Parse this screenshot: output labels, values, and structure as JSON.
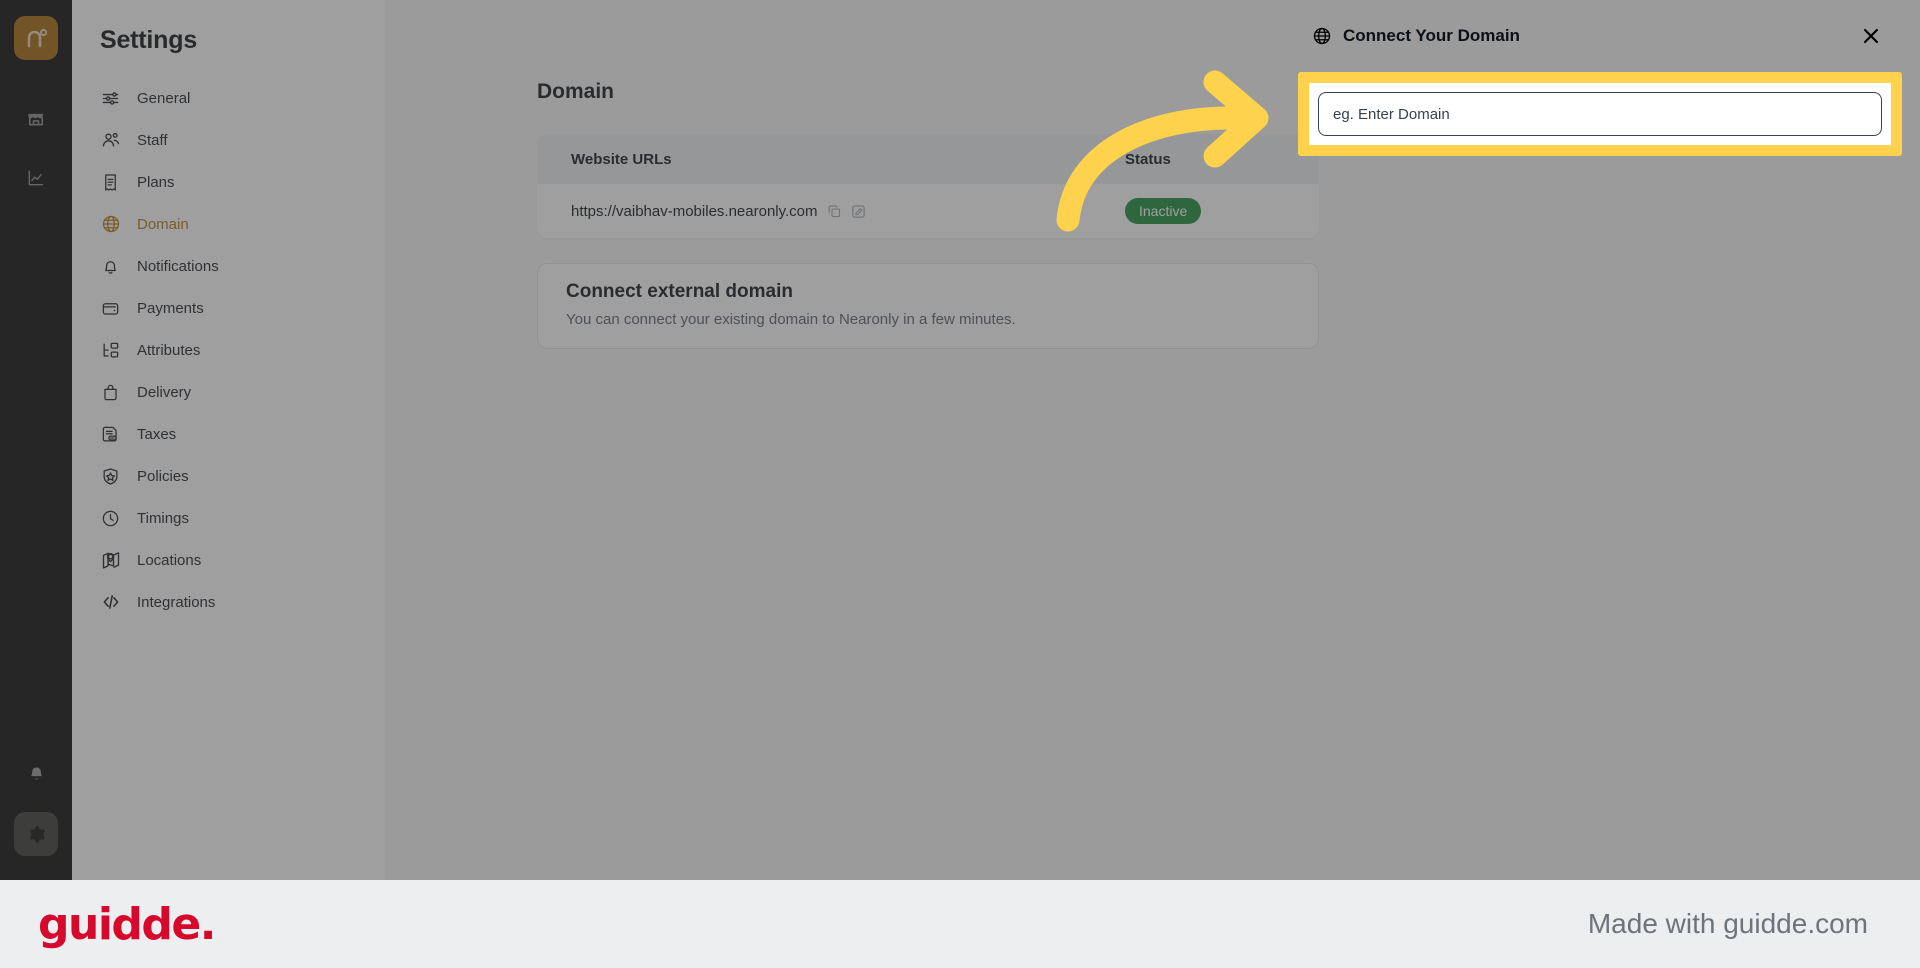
{
  "rail": {
    "logo_alt": "nearonly-logo",
    "items": [
      {
        "name": "store-icon"
      },
      {
        "name": "analytics-icon"
      }
    ],
    "bell": "notifications-icon",
    "gear": "settings-icon"
  },
  "sidebar": {
    "title": "Settings",
    "items": [
      {
        "label": "General",
        "icon": "sliders-icon",
        "active": false
      },
      {
        "label": "Staff",
        "icon": "users-icon",
        "active": false
      },
      {
        "label": "Plans",
        "icon": "receipt-icon",
        "active": false
      },
      {
        "label": "Domain",
        "icon": "globe-icon",
        "active": true
      },
      {
        "label": "Notifications",
        "icon": "bell-icon",
        "active": false
      },
      {
        "label": "Payments",
        "icon": "wallet-icon",
        "active": false
      },
      {
        "label": "Attributes",
        "icon": "hierarchy-icon",
        "active": false
      },
      {
        "label": "Delivery",
        "icon": "bag-icon",
        "active": false
      },
      {
        "label": "Taxes",
        "icon": "tax-document-icon",
        "active": false
      },
      {
        "label": "Policies",
        "icon": "shield-icon",
        "active": false
      },
      {
        "label": "Timings",
        "icon": "clock-icon",
        "active": false
      },
      {
        "label": "Locations",
        "icon": "map-icon",
        "active": false
      },
      {
        "label": "Integrations",
        "icon": "code-icon",
        "active": false
      }
    ]
  },
  "main": {
    "page_title": "Domain",
    "table": {
      "headers": {
        "urls": "Website URLs",
        "status": "Status"
      },
      "rows": [
        {
          "url": "https://vaibhav-mobiles.nearonly.com",
          "copy_icon": "copy-icon",
          "edit_icon": "edit-icon",
          "status": "Inactive",
          "status_color": "#1c8c3c"
        }
      ]
    },
    "connect_card": {
      "title": "Connect external domain",
      "subtitle": "You can connect your existing domain to Nearonly in a few minutes."
    }
  },
  "drawer": {
    "title": "Connect Your Domain",
    "globe_icon": "globe-icon",
    "close_icon": "close-icon",
    "input": {
      "value": "",
      "placeholder": "eg. Enter Domain"
    },
    "highlight_color": "#ffd24d"
  },
  "annotation": {
    "arrow_color": "#ffd24d",
    "arrow_name": "curved-arrow-pointer"
  },
  "footer": {
    "logo": "guidde.",
    "logo_color": "#d6082b",
    "made_with": "Made with guidde.com"
  }
}
